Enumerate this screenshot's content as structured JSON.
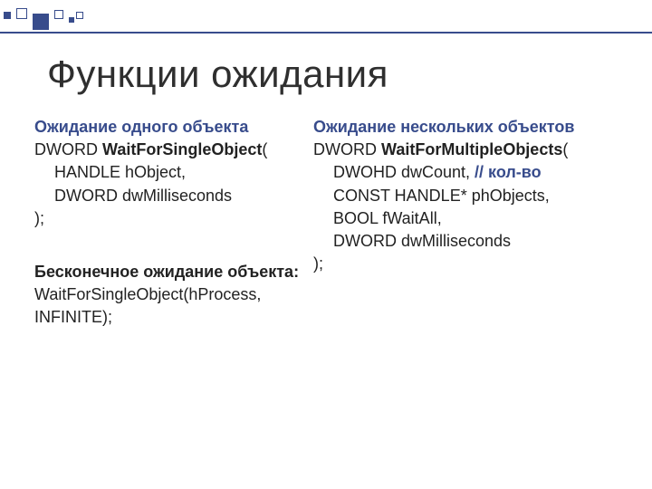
{
  "title": "Функции ожидания",
  "left": {
    "heading": "Ожидание одного объекта",
    "ret": "DWORD ",
    "fn": "WaitForSingleObject",
    "open": "(",
    "p1": "HANDLE hObject,",
    "p2": "DWORD dwMilliseconds",
    "close": ");"
  },
  "right": {
    "heading": "Ожидание нескольких объектов",
    "ret": "DWORD ",
    "fn": "WaitForMultipleObjects",
    "open": "(",
    "p1": "DWOHD dwCount, ",
    "p1c": "// кол-во",
    "p2": "CONST HANDLE* phObjects,",
    "p3": "BOOL fWaitAll,",
    "p4": "DWORD dwMilliseconds",
    "close": ");"
  },
  "infinite": {
    "heading": "Бесконечное ожидание объекта:",
    "code": "WaitForSingleObject(hProcess, INFINITE);"
  },
  "colors": {
    "accent": "#384c8c",
    "text": "#222222",
    "background": "#ffffff"
  }
}
